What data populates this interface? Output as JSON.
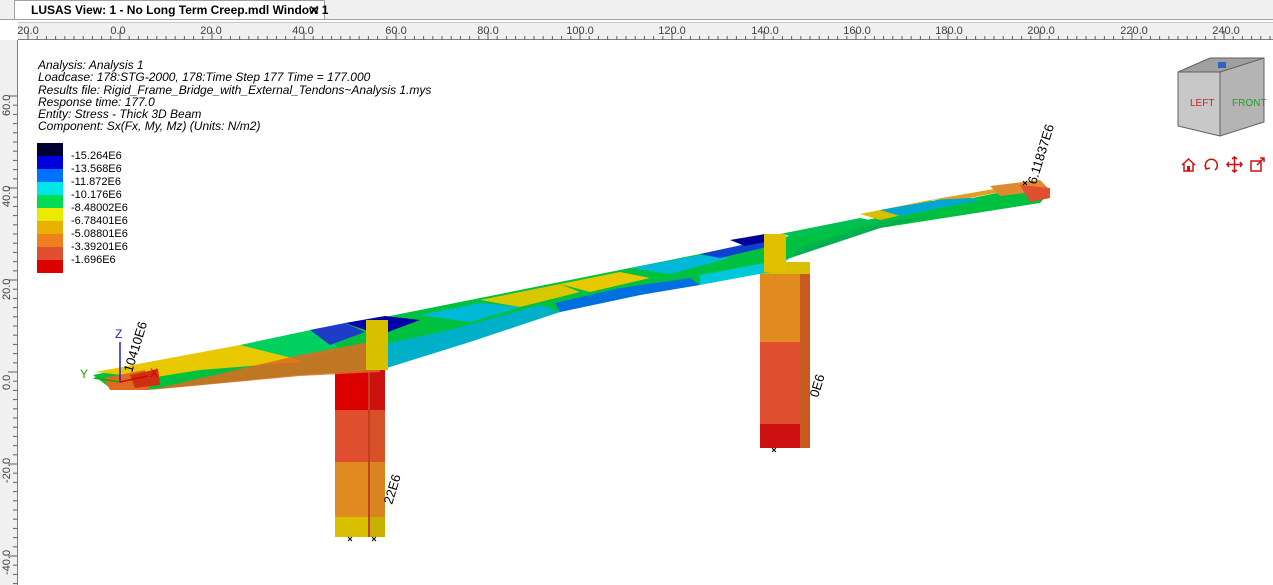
{
  "window": {
    "tab_title": "LUSAS View: 1 - No Long Term Creep.mdl Window 1",
    "close_glyph": "✕"
  },
  "ruler_top": [
    "20.0",
    "0.0",
    "20.0",
    "40.0",
    "60.0",
    "80.0",
    "100.0",
    "120.0",
    "140.0",
    "160.0",
    "180.0",
    "200.0",
    "220.0",
    "240.0"
  ],
  "ruler_left": [
    "60.0",
    "40.0",
    "20.0",
    "0.0",
    "-20.0",
    "-40.0"
  ],
  "info": [
    "Analysis: Analysis 1",
    "Loadcase: 178:STG-2000, 178:Time Step 177 Time = 177.000",
    "Results file: Rigid_Frame_Bridge_with_External_Tendons~Analysis 1.mys",
    "Response time: 177.0",
    "Entity: Stress - Thick 3D Beam",
    "Component: Sx(Fx, My, Mz) (Units: N/m2)"
  ],
  "legend": {
    "colors": [
      "#000033",
      "#0000dd",
      "#0070ff",
      "#00e5e5",
      "#00dd55",
      "#eaea00",
      "#e8b000",
      "#ee8020",
      "#e05030",
      "#dd0000"
    ],
    "labels": [
      "-15.264E6",
      "-13.568E6",
      "-11.872E6",
      "-10.176E6",
      "-8.48002E6",
      "-6.78401E6",
      "-5.08801E6",
      "-3.39201E6",
      "-1.696E6"
    ]
  },
  "annotations": {
    "left_end": "10410E6",
    "right_end": "6.11837E6",
    "pier1": "22E6",
    "pier2": "0E6"
  },
  "axes": {
    "x": "X",
    "y": "Y",
    "z": "Z"
  },
  "view_cube": {
    "left": "LEFT",
    "front": "FRONT"
  },
  "icons": [
    "home-icon",
    "rotate-icon",
    "pan-icon",
    "zoom-icon"
  ]
}
